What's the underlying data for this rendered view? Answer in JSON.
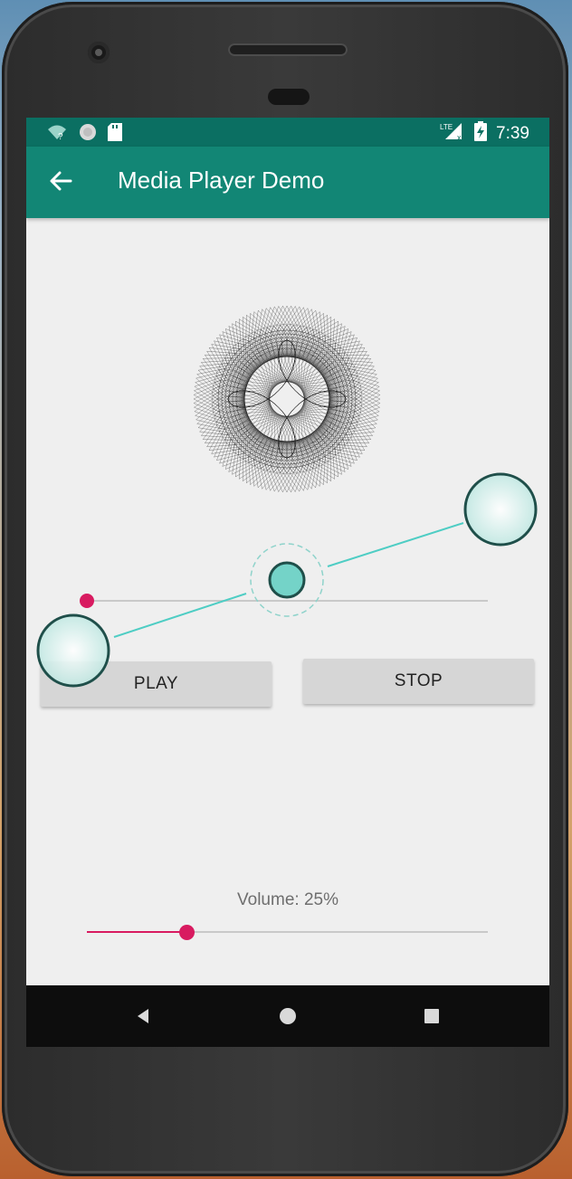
{
  "status_bar": {
    "time": "7:39",
    "icons": [
      "wifi-unknown-icon",
      "sync-icon",
      "sd-card-icon",
      "lte-signal-icon",
      "battery-charging-icon"
    ],
    "lte_label": "LTE"
  },
  "app_bar": {
    "title": "Media Player Demo",
    "back_icon": "arrow-back-icon"
  },
  "player": {
    "artwork": "spirograph-artwork",
    "seek_progress": 0,
    "play_label": "PLAY",
    "stop_label": "STOP",
    "volume_label": "Volume: 25%",
    "volume_level": 0.25
  },
  "nav_bar": {
    "icons": [
      "nav-back-icon",
      "nav-home-icon",
      "nav-recents-icon"
    ]
  },
  "colors": {
    "status_bar": "#0b6f62",
    "app_bar": "#128675",
    "accent": "#d81b60",
    "background": "#efefef",
    "button": "#d6d6d6",
    "gesture": "#4ecdc4"
  }
}
